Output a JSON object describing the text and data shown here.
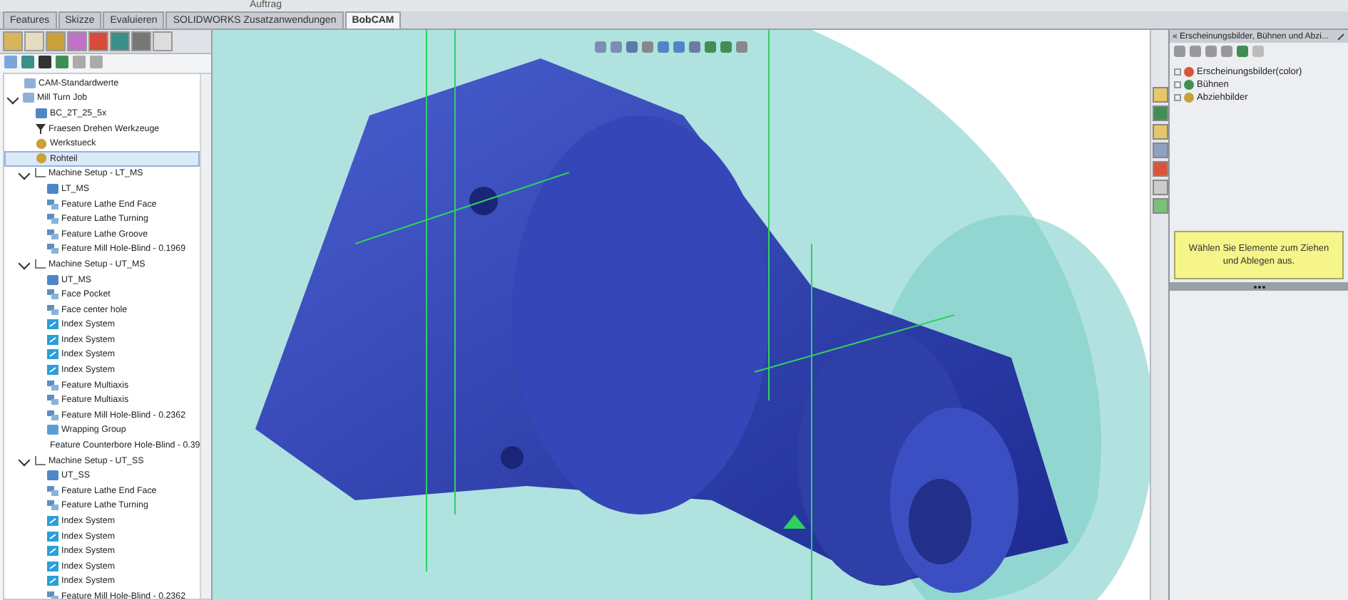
{
  "ribbon": {
    "group_label": "Auftrag"
  },
  "tabs": [
    {
      "label": "Features",
      "selected": false
    },
    {
      "label": "Skizze",
      "selected": false
    },
    {
      "label": "Evaluieren",
      "selected": false
    },
    {
      "label": "SOLIDWORKS Zusatzanwendungen",
      "selected": false
    },
    {
      "label": "BobCAM",
      "selected": true
    }
  ],
  "tree": [
    {
      "label": "CAM-Standardwerte",
      "kind": "folder"
    },
    {
      "label": "Mill Turn Job",
      "kind": "folder",
      "expanded": true,
      "children": [
        {
          "label": "BC_2T_25_5x",
          "kind": "machine"
        },
        {
          "label": "Fraesen Drehen Werkzeuge",
          "kind": "tool"
        },
        {
          "label": "Werkstueck",
          "kind": "stock"
        },
        {
          "label": "Rohteil",
          "kind": "stock",
          "selected": true
        },
        {
          "label": "Machine Setup - LT_MS",
          "kind": "setup",
          "expanded": true,
          "children": [
            {
              "label": "LT_MS",
              "kind": "machine"
            },
            {
              "label": "Feature Lathe End Face",
              "kind": "feature"
            },
            {
              "label": "Feature Lathe Turning",
              "kind": "feature"
            },
            {
              "label": "Feature Lathe Groove",
              "kind": "feature"
            },
            {
              "label": "Feature Mill Hole-Blind - 0.1969",
              "kind": "feature"
            }
          ]
        },
        {
          "label": "Machine Setup - UT_MS",
          "kind": "setup",
          "expanded": true,
          "children": [
            {
              "label": "UT_MS",
              "kind": "machine"
            },
            {
              "label": "Face Pocket",
              "kind": "feature"
            },
            {
              "label": "Face center hole",
              "kind": "feature"
            },
            {
              "label": "Index System",
              "kind": "index"
            },
            {
              "label": "Index System",
              "kind": "index"
            },
            {
              "label": "Index System",
              "kind": "index"
            },
            {
              "label": "Index System",
              "kind": "index"
            },
            {
              "label": "Feature Multiaxis",
              "kind": "feature"
            },
            {
              "label": "Feature Multiaxis",
              "kind": "feature"
            },
            {
              "label": "Feature Mill Hole-Blind - 0.2362",
              "kind": "feature"
            },
            {
              "label": "Wrapping Group",
              "kind": "wrap"
            },
            {
              "label": "Feature Counterbore Hole-Blind - 0.39",
              "kind": "feature"
            }
          ]
        },
        {
          "label": "Machine Setup - UT_SS",
          "kind": "setup",
          "expanded": true,
          "children": [
            {
              "label": "UT_SS",
              "kind": "machine"
            },
            {
              "label": "Feature Lathe End Face",
              "kind": "feature"
            },
            {
              "label": "Feature Lathe Turning",
              "kind": "feature"
            },
            {
              "label": "Index System",
              "kind": "index"
            },
            {
              "label": "Index System",
              "kind": "index"
            },
            {
              "label": "Index System",
              "kind": "index"
            },
            {
              "label": "Index System",
              "kind": "index"
            },
            {
              "label": "Index System",
              "kind": "index"
            },
            {
              "label": "Feature Mill Hole-Blind - 0.2362",
              "kind": "feature"
            }
          ]
        }
      ]
    }
  ],
  "task_pane": {
    "title": "« Erscheinungsbilder, Bühnen und Abzi...",
    "items": [
      {
        "label": "Erscheinungsbilder(color)",
        "kind": "appearance"
      },
      {
        "label": "Bühnen",
        "kind": "scene"
      },
      {
        "label": "Abziehbilder",
        "kind": "decal"
      }
    ],
    "hint": "Wählen Sie Elemente zum Ziehen und Ablegen aus."
  }
}
